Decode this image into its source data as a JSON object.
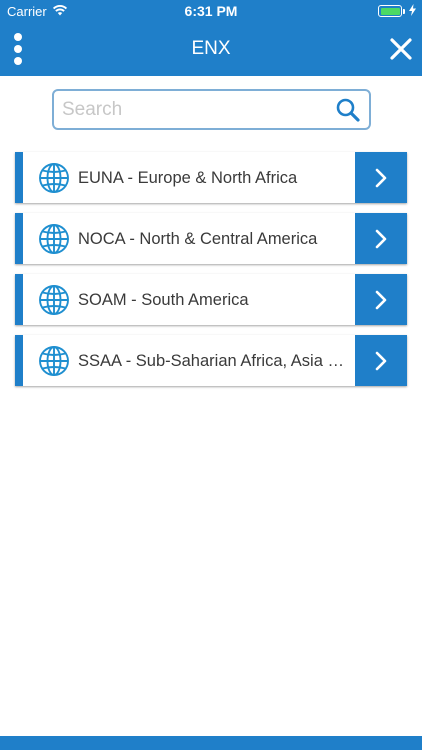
{
  "status_bar": {
    "carrier": "Carrier",
    "time": "6:31 PM"
  },
  "navbar": {
    "title": "ENX",
    "menu_icon": "vertical-dots-icon",
    "close_icon": "close-icon"
  },
  "search": {
    "placeholder": "Search",
    "value": "",
    "icon": "search-icon"
  },
  "regions": [
    {
      "label": "EUNA - Europe & North Africa",
      "icon": "globe-icon"
    },
    {
      "label": "NOCA - North & Central America",
      "icon": "globe-icon"
    },
    {
      "label": "SOAM - South America",
      "icon": "globe-icon"
    },
    {
      "label": "SSAA - Sub-Saharian Africa, Asia & Australia",
      "icon": "globe-icon"
    }
  ],
  "colors": {
    "primary": "#1f7fc9",
    "search_border": "#7eaed6",
    "battery": "#4cd964",
    "text": "#3a3a3a"
  }
}
